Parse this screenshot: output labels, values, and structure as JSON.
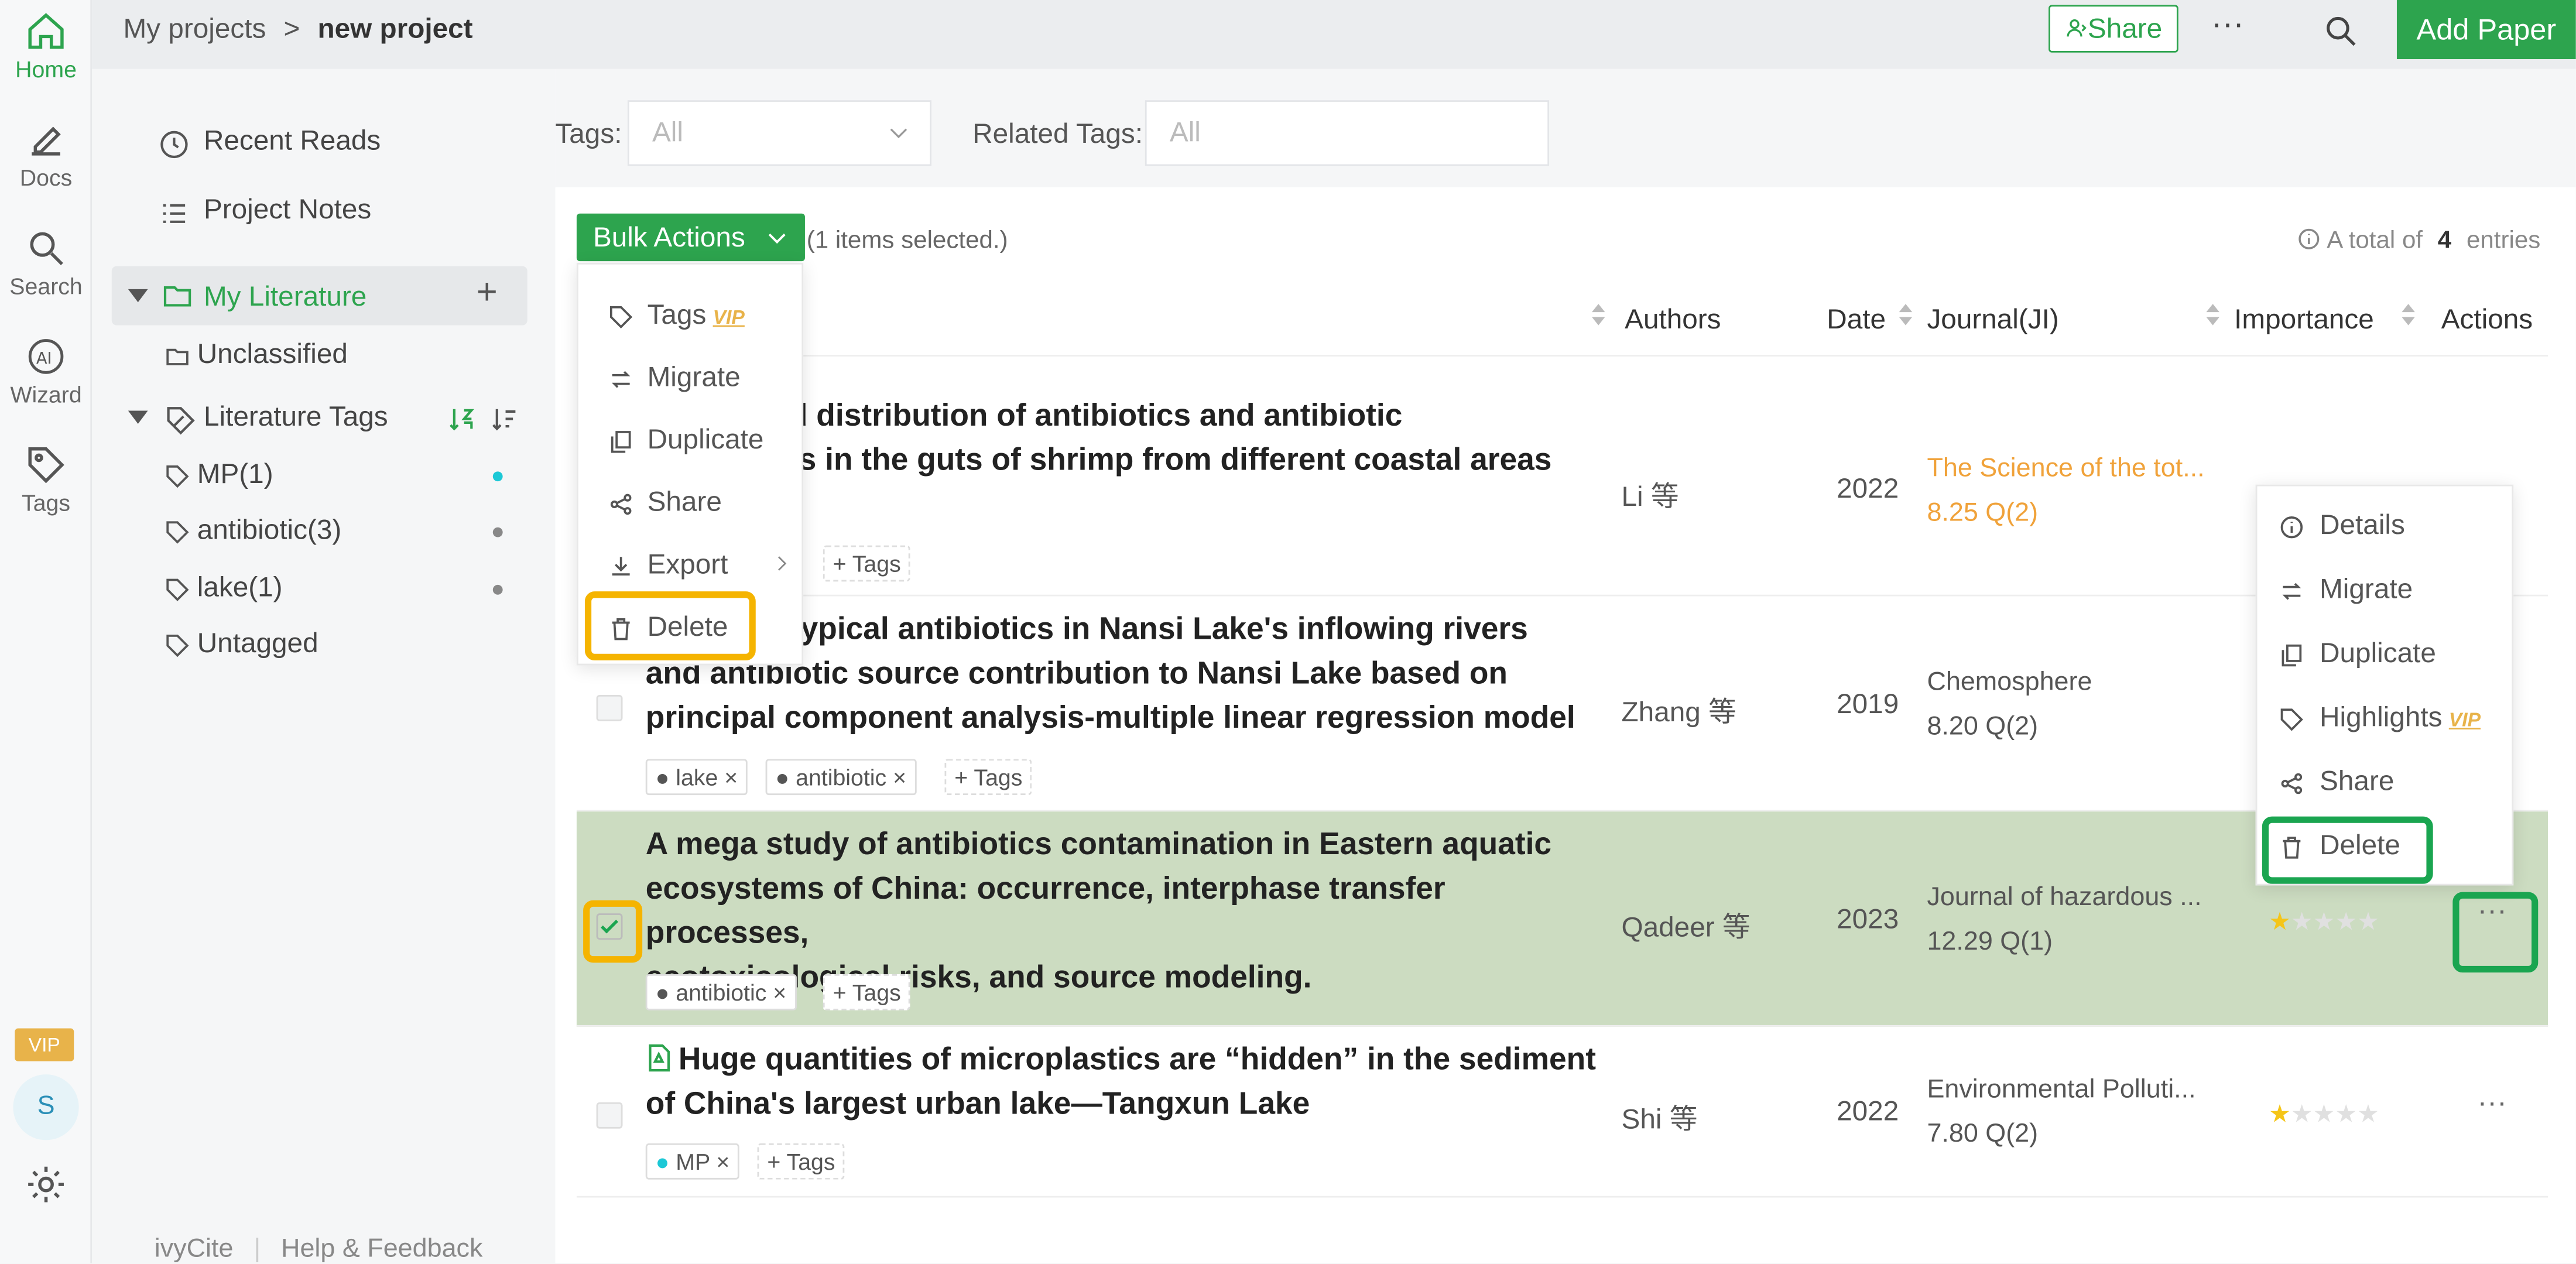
{
  "rail": {
    "items": [
      {
        "label": "Home",
        "icon": "home-icon"
      },
      {
        "label": "Docs",
        "icon": "pen-icon"
      },
      {
        "label": "Search",
        "icon": "search-icon"
      },
      {
        "label": "Wizard",
        "icon": "ai-icon"
      },
      {
        "label": "Tags",
        "icon": "tag-icon"
      }
    ],
    "vip": "VIP",
    "avatar": "S"
  },
  "topbar": {
    "breadcrumb_root": "My projects",
    "breadcrumb_sep": ">",
    "breadcrumb_current": "new project",
    "share": "Share",
    "more": "···",
    "add_paper": "Add Paper"
  },
  "sidebar": {
    "recent_reads": "Recent Reads",
    "project_notes": "Project Notes",
    "my_literature": "My Literature",
    "unclassified": "Unclassified",
    "literature_tags": "Literature Tags",
    "tags": [
      {
        "label": "MP(1)",
        "color": "#1cc8d6"
      },
      {
        "label": "antibiotic(3)",
        "color": "#888888"
      },
      {
        "label": "lake(1)",
        "color": "#888888"
      },
      {
        "label": "Untagged",
        "color": ""
      }
    ],
    "footer_brand": "ivyCite",
    "footer_sep": "|",
    "footer_help": "Help & Feedback"
  },
  "filters": {
    "tags_label": "Tags:",
    "tags_value": "All",
    "related_label": "Related Tags:",
    "related_value": "All"
  },
  "toolbar": {
    "bulk_actions": "Bulk Actions",
    "selected": "(1 items selected.)",
    "total_prefix": "A total of",
    "total_count": "4",
    "total_suffix": "entries"
  },
  "table": {
    "headers": {
      "authors": "Authors",
      "date": "Date",
      "journal": "Journal(JI)",
      "importance": "Importance",
      "actions": "Actions"
    },
    "rows": [
      {
        "title_line1": "e and distribution of antibiotics and antibiotic",
        "title_line2": "genes in the guts of shrimp from different coastal areas",
        "authors": "Li 等",
        "date": "2022",
        "journal": "The Science of the tot...",
        "impact": "8.25 Q(2)",
        "tags": [],
        "add_tag": "Tags"
      },
      {
        "title_line1": "e of typical antibiotics in Nansi Lake's inflowing rivers",
        "title_line2": "and antibiotic source contribution to Nansi Lake based on",
        "title_line3": "principal component analysis-multiple linear regression model",
        "authors": "Zhang 等",
        "date": "2019",
        "journal": "Chemosphere",
        "impact": "8.20 Q(2)",
        "tags": [
          "lake",
          "antibiotic"
        ],
        "add_tag": "Tags"
      },
      {
        "title_line1": "A mega study of antibiotics contamination in Eastern aquatic",
        "title_line2": "ecosystems of China: occurrence, interphase transfer processes,",
        "title_line3": "ecotoxicological risks, and source modeling.",
        "authors": "Qadeer 等",
        "date": "2023",
        "journal": "Journal of hazardous ...",
        "impact": "12.29 Q(1)",
        "tags": [
          "antibiotic"
        ],
        "add_tag": "Tags",
        "stars": 1,
        "selected": true
      },
      {
        "title_line1": "Huge quantities of microplastics are “hidden” in the sediment",
        "title_line2": "of China's largest urban lake—Tangxun Lake",
        "authors": "Shi 等",
        "date": "2022",
        "journal": "Environmental Polluti...",
        "impact": "7.80 Q(2)",
        "tags": [
          "MP"
        ],
        "add_tag": "Tags",
        "stars": 1
      }
    ]
  },
  "bulk_menu": {
    "items": [
      {
        "label": "Tags",
        "vip": "VIP"
      },
      {
        "label": "Migrate"
      },
      {
        "label": "Duplicate"
      },
      {
        "label": "Share"
      },
      {
        "label": "Export"
      },
      {
        "label": "Delete"
      }
    ]
  },
  "row_menu": {
    "items": [
      {
        "label": "Details"
      },
      {
        "label": "Migrate"
      },
      {
        "label": "Duplicate"
      },
      {
        "label": "Highlights",
        "vip": "VIP"
      },
      {
        "label": "Share"
      },
      {
        "label": "Delete"
      }
    ]
  },
  "colors": {
    "accent": "#2da44e",
    "selected_row": "#ccdcc1",
    "highlight_orange": "#f5b400",
    "highlight_green": "#1aa550"
  }
}
